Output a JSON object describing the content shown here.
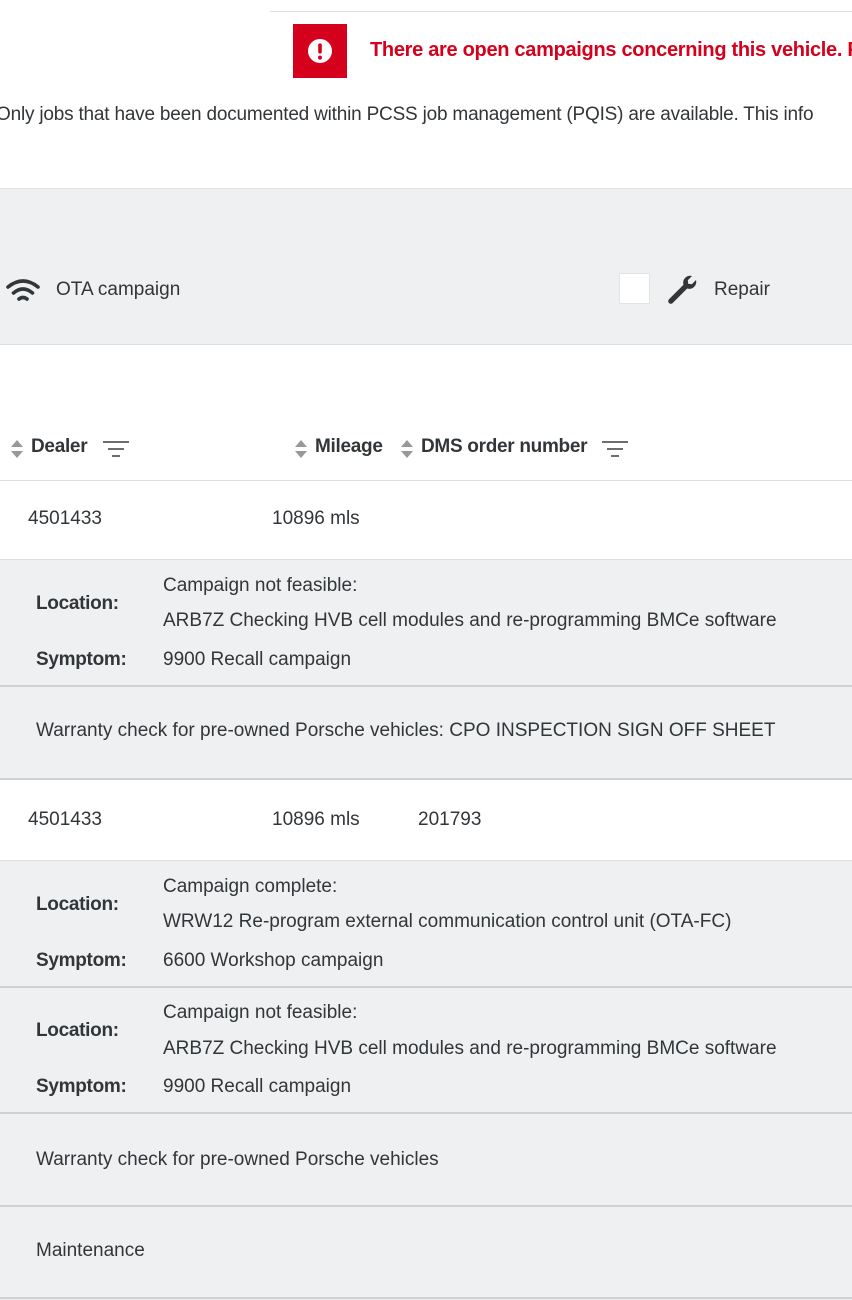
{
  "alert": {
    "icon": "exclamation-icon",
    "color": "#d5001c",
    "text": "There are open campaigns concerning this vehicle. Ple"
  },
  "info_text": "Only jobs that have been documented within PCSS job management (PQIS) are available. This info",
  "filters": {
    "ota_label": "OTA campaign",
    "ota_icon": "wifi-icon",
    "repair_label": "Repair",
    "repair_icon": "wrench-icon"
  },
  "table": {
    "columns": {
      "dealer": "Dealer",
      "mileage": "Mileage",
      "dms_order_number": "DMS order number"
    },
    "rows": [
      {
        "dealer": "4501433",
        "mileage": "10896 mls",
        "dms_order_number": "",
        "entries": [
          {
            "status": "Campaign not feasible:",
            "location_label": "Location:",
            "location": "ARB7Z Checking HVB cell modules and re-programming BMCe software",
            "symptom_label": "Symptom:",
            "symptom": "9900 Recall campaign"
          }
        ],
        "notes": [
          "Warranty check for pre-owned Porsche vehicles: CPO INSPECTION SIGN OFF SHEET"
        ]
      },
      {
        "dealer": "4501433",
        "mileage": "10896 mls",
        "dms_order_number": "201793",
        "entries": [
          {
            "status": "Campaign complete:",
            "location_label": "Location:",
            "location": "WRW12 Re-program external communication control unit (OTA-FC)",
            "symptom_label": "Symptom:",
            "symptom": "6600 Workshop campaign"
          },
          {
            "status": "Campaign not feasible:",
            "location_label": "Location:",
            "location": "ARB7Z Checking HVB cell modules and re-programming BMCe software",
            "symptom_label": "Symptom:",
            "symptom": "9900 Recall campaign"
          }
        ],
        "notes": [
          "Warranty check for pre-owned Porsche vehicles",
          "Maintenance"
        ]
      }
    ]
  }
}
